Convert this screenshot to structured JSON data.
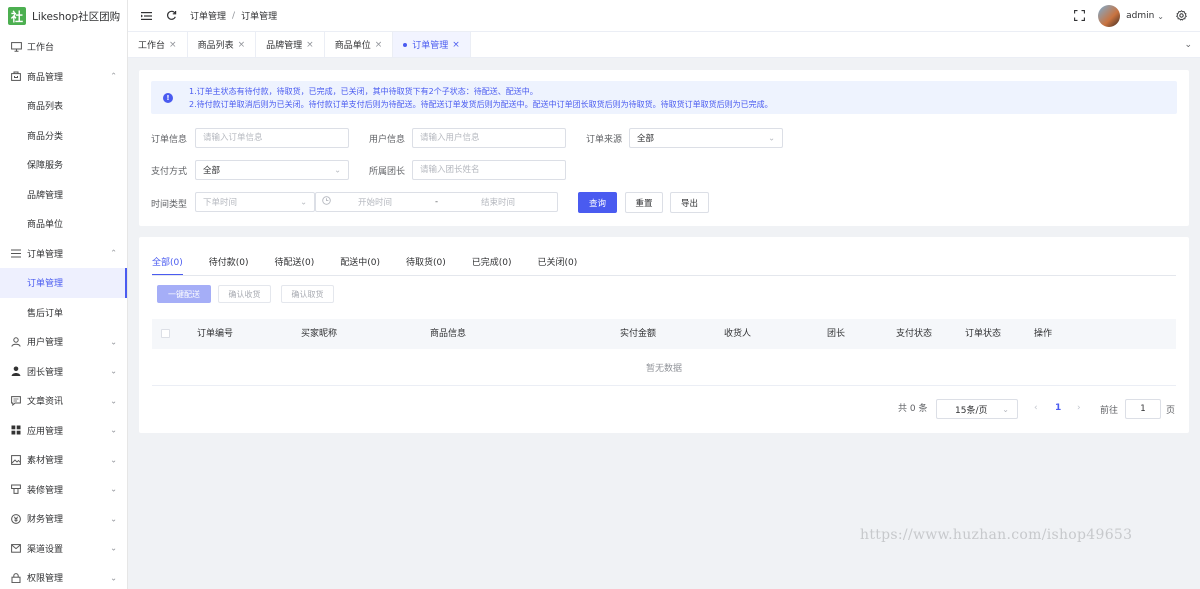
{
  "app": {
    "logo_mark": "社",
    "logo_text": "Likeshop社区团购"
  },
  "sidebar": {
    "items": [
      {
        "label": "工作台",
        "icon": "monitor-icon",
        "type": "top"
      },
      {
        "label": "商品管理",
        "icon": "shop-icon",
        "type": "group",
        "expanded": true
      },
      {
        "label": "商品列表",
        "type": "sub"
      },
      {
        "label": "商品分类",
        "type": "sub"
      },
      {
        "label": "保障服务",
        "type": "sub"
      },
      {
        "label": "品牌管理",
        "type": "sub"
      },
      {
        "label": "商品单位",
        "type": "sub"
      },
      {
        "label": "订单管理",
        "icon": "list-icon",
        "type": "group",
        "expanded": true
      },
      {
        "label": "订单管理",
        "type": "sub",
        "active": true
      },
      {
        "label": "售后订单",
        "type": "sub"
      },
      {
        "label": "用户管理",
        "icon": "user-icon",
        "type": "group"
      },
      {
        "label": "团长管理",
        "icon": "person-icon",
        "type": "group"
      },
      {
        "label": "文章资讯",
        "icon": "chat-icon",
        "type": "group"
      },
      {
        "label": "应用管理",
        "icon": "apps-icon",
        "type": "group"
      },
      {
        "label": "素材管理",
        "icon": "image-icon",
        "type": "group"
      },
      {
        "label": "装修管理",
        "icon": "decor-icon",
        "type": "group"
      },
      {
        "label": "财务管理",
        "icon": "finance-icon",
        "type": "group"
      },
      {
        "label": "渠道设置",
        "icon": "mail-icon",
        "type": "group"
      },
      {
        "label": "权限管理",
        "icon": "lock-icon",
        "type": "group"
      }
    ]
  },
  "header": {
    "breadcrumb": [
      "订单管理",
      "订单管理"
    ],
    "breadcrumb_sep": "/",
    "user_name": "admin"
  },
  "tabs": [
    {
      "label": "工作台"
    },
    {
      "label": "商品列表"
    },
    {
      "label": "品牌管理"
    },
    {
      "label": "商品单位"
    },
    {
      "label": "订单管理",
      "active": true
    }
  ],
  "alert": {
    "icon": "info-icon",
    "line1": "1.订单主状态有待付款，待取货，已完成，已关闭，其中待取货下有2个子状态：待配送、配送中。",
    "line2": "2.待付款订单取消后则为已关闭。待付款订单支付后则为待配送。待配送订单发货后则为配送中。配送中订单团长取货后则为待取货。待取货订单取货后则为已完成。"
  },
  "filters": {
    "order_info": {
      "label": "订单信息",
      "placeholder": "请输入订单信息"
    },
    "user_info": {
      "label": "用户信息",
      "placeholder": "请输入用户信息"
    },
    "order_source": {
      "label": "订单来源",
      "value": "全部"
    },
    "pay_method": {
      "label": "支付方式",
      "value": "全部"
    },
    "leader": {
      "label": "所属团长",
      "placeholder": "请输入团长姓名"
    },
    "time_type": {
      "label": "时间类型",
      "value": "下单时间"
    },
    "date_range": {
      "start_placeholder": "开始时间",
      "separator": "-",
      "end_placeholder": "结束时间"
    },
    "query_label": "查询",
    "reset_label": "重置",
    "export_label": "导出"
  },
  "status_tabs": [
    {
      "label": "全部(0)",
      "active": true
    },
    {
      "label": "待付款(0)"
    },
    {
      "label": "待配送(0)"
    },
    {
      "label": "配送中(0)"
    },
    {
      "label": "待取货(0)"
    },
    {
      "label": "已完成(0)"
    },
    {
      "label": "已关闭(0)"
    }
  ],
  "actions": {
    "deliver_label": "一键配送",
    "confirm_receive_label": "确认收货",
    "confirm_cancel_label": "确认取货"
  },
  "table": {
    "columns": [
      "订单编号",
      "买家昵称",
      "商品信息",
      "实付金额",
      "收货人",
      "团长",
      "支付状态",
      "订单状态",
      "操作"
    ],
    "empty_text": "暂无数据"
  },
  "pagination": {
    "total_text": "共 0 条",
    "page_size": "15条/页",
    "current_page": "1",
    "goto_label": "前往",
    "goto_value": "1",
    "page_suffix": "页"
  },
  "watermark": "https://www.huzhan.com/ishop49653"
}
